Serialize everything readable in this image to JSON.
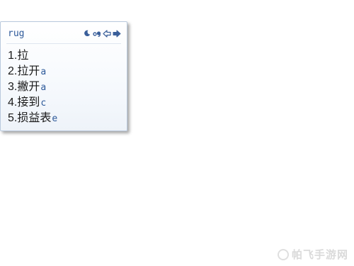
{
  "ime": {
    "pinyin": "rug",
    "toolbar": {
      "icons": [
        "moon-icon",
        "ime-mode-icon",
        "prev-page-icon",
        "next-page-icon"
      ],
      "accent": "#2e5a9a"
    },
    "candidates": [
      {
        "num": "1.",
        "word": "拉",
        "hint": ""
      },
      {
        "num": "2.",
        "word": "拉开",
        "hint": "a"
      },
      {
        "num": "3.",
        "word": "撇开",
        "hint": "a"
      },
      {
        "num": "4.",
        "word": "接到",
        "hint": "c"
      },
      {
        "num": "5.",
        "word": "损益表",
        "hint": "e"
      }
    ]
  },
  "watermark": {
    "text": "帕飞手游网"
  }
}
